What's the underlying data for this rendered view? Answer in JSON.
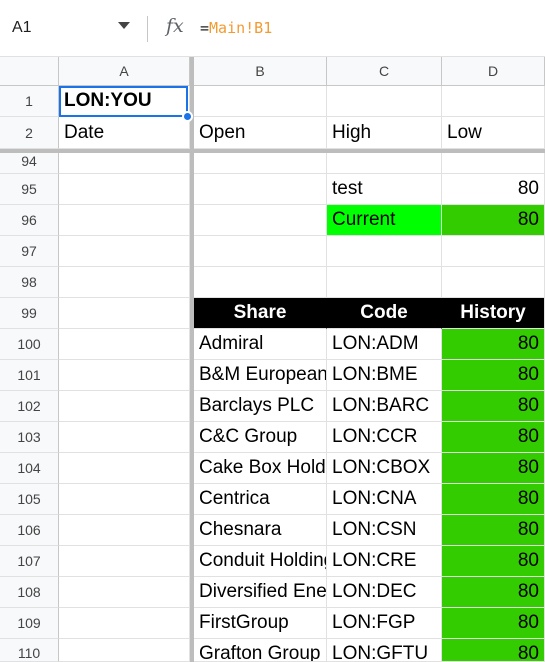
{
  "formula_bar": {
    "cell_ref": "A1",
    "fx_label": "fx",
    "formula_eq": "=",
    "formula_ref": "Main!B1"
  },
  "columns": [
    "A",
    "B",
    "C",
    "D"
  ],
  "frozen_rows": [
    {
      "num": "1",
      "A": "LON:YOU",
      "B": "",
      "C": "",
      "D": ""
    },
    {
      "num": "2",
      "A": "Date",
      "B": "Open",
      "C": "High",
      "D": "Low"
    }
  ],
  "rows": [
    {
      "num": "94",
      "A": "",
      "B": "",
      "C": "",
      "D": ""
    },
    {
      "num": "95",
      "A": "",
      "B": "",
      "C": "test",
      "D": "80"
    },
    {
      "num": "96",
      "A": "",
      "B": "",
      "C": "Current",
      "D": "80"
    },
    {
      "num": "97",
      "A": "",
      "B": "",
      "C": "",
      "D": ""
    },
    {
      "num": "98",
      "A": "",
      "B": "",
      "C": "",
      "D": ""
    },
    {
      "num": "99",
      "A": "",
      "B": "Share",
      "C": "Code",
      "D": "History"
    },
    {
      "num": "100",
      "A": "",
      "B": "Admiral",
      "C": "LON:ADM",
      "D": "80"
    },
    {
      "num": "101",
      "A": "",
      "B": "B&M European",
      "C": "LON:BME",
      "D": "80"
    },
    {
      "num": "102",
      "A": "",
      "B": "Barclays PLC",
      "C": "LON:BARC",
      "D": "80"
    },
    {
      "num": "103",
      "A": "",
      "B": "C&C Group",
      "C": "LON:CCR",
      "D": "80"
    },
    {
      "num": "104",
      "A": "",
      "B": "Cake Box Holdings",
      "C": "LON:CBOX",
      "D": "80"
    },
    {
      "num": "105",
      "A": "",
      "B": "Centrica",
      "C": "LON:CNA",
      "D": "80"
    },
    {
      "num": "106",
      "A": "",
      "B": "Chesnara",
      "C": "LON:CSN",
      "D": "80"
    },
    {
      "num": "107",
      "A": "",
      "B": "Conduit Holdings",
      "C": "LON:CRE",
      "D": "80"
    },
    {
      "num": "108",
      "A": "",
      "B": "Diversified Energy",
      "C": "LON:DEC",
      "D": "80"
    },
    {
      "num": "109",
      "A": "",
      "B": "FirstGroup",
      "C": "LON:FGP",
      "D": "80"
    },
    {
      "num": "110",
      "A": "",
      "B": "Grafton Group",
      "C": "LON:GFTU",
      "D": "80"
    }
  ],
  "colors": {
    "history_green": "#33cc00",
    "current_green": "#00ff00",
    "header_black": "#000000",
    "selection_blue": "#1a73e8"
  }
}
